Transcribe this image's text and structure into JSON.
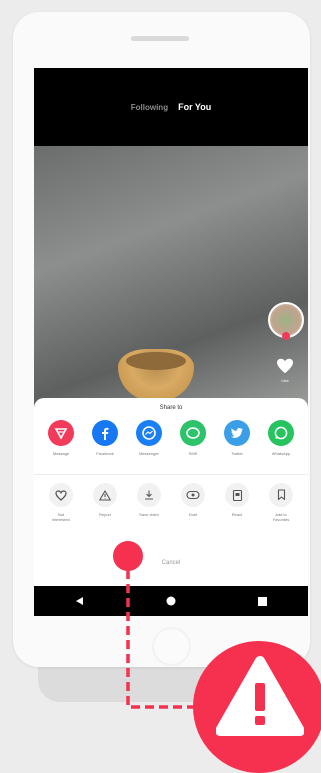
{
  "feed": {
    "tabs": [
      {
        "label": "Following",
        "active": false
      },
      {
        "label": "For You",
        "active": true
      }
    ],
    "like_count": "Like"
  },
  "share_sheet": {
    "title": "Share to",
    "share_targets": [
      {
        "label": "Message",
        "icon": "message-icon",
        "color": "#f23b5a"
      },
      {
        "label": "Facebook",
        "icon": "facebook-icon",
        "color": "#1877f2"
      },
      {
        "label": "Messenger",
        "icon": "messenger-icon",
        "color": "#1a7ef5"
      },
      {
        "label": "SMS",
        "icon": "sms-icon",
        "color": "#2cc36b"
      },
      {
        "label": "Twitter",
        "icon": "twitter-icon",
        "color": "#3b9fe8"
      },
      {
        "label": "WhatsApp",
        "icon": "whatsapp-icon",
        "color": "#25c45e"
      }
    ],
    "actions": [
      {
        "label": "Not\ninterested",
        "icon": "broken-heart-icon"
      },
      {
        "label": "Report",
        "icon": "report-warning-icon"
      },
      {
        "label": "Save video",
        "icon": "download-icon"
      },
      {
        "label": "Duet",
        "icon": "duet-icon"
      },
      {
        "label": "React",
        "icon": "react-icon"
      },
      {
        "label": "Add to\nFavorites",
        "icon": "bookmark-icon"
      }
    ],
    "cancel_label": "Cancel"
  },
  "android_nav": {
    "buttons": [
      "back-icon",
      "home-icon",
      "recents-icon"
    ]
  },
  "colors": {
    "accent": "#f6304f",
    "screen_bg": "#000000"
  }
}
